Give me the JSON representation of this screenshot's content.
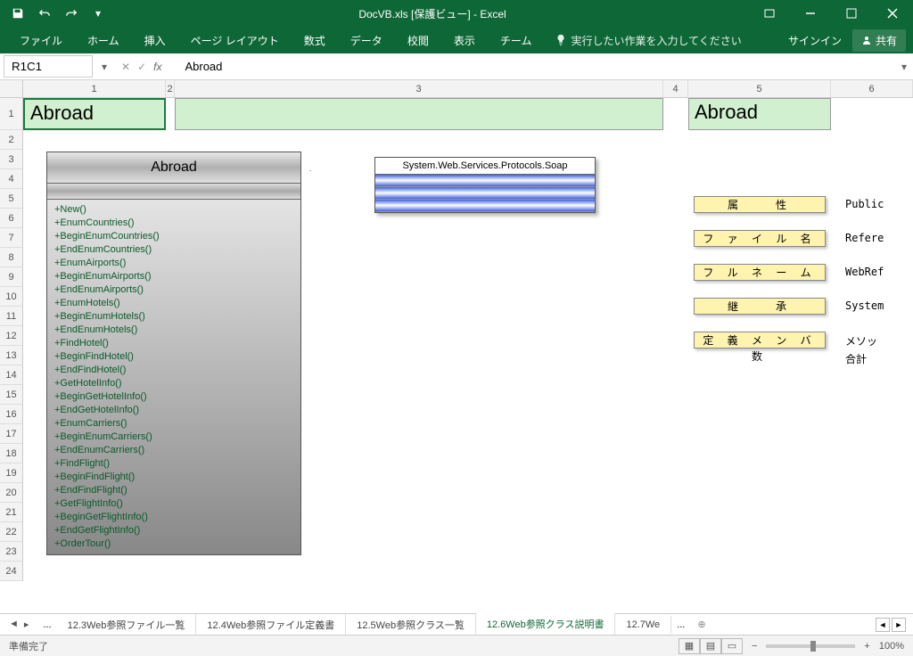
{
  "titlebar": {
    "title": "DocVB.xls  [保護ビュー] - Excel"
  },
  "ribbon": {
    "tabs": [
      "ファイル",
      "ホーム",
      "挿入",
      "ページ レイアウト",
      "数式",
      "データ",
      "校閲",
      "表示",
      "チーム"
    ],
    "tell_me": "実行したい作業を入力してください",
    "signin": "サインイン",
    "share": "共有"
  },
  "formula_bar": {
    "name_box": "R1C1",
    "fx": "fx",
    "formula": "Abroad"
  },
  "columns": [
    "1",
    "2",
    "3",
    "4",
    "5",
    "6"
  ],
  "rows": [
    "1",
    "2",
    "3",
    "4",
    "5",
    "6",
    "7",
    "8",
    "9",
    "10",
    "11",
    "12",
    "13",
    "14",
    "15",
    "16",
    "17",
    "18",
    "19",
    "20",
    "21",
    "22",
    "23",
    "24"
  ],
  "headers": {
    "c1": "Abroad",
    "c3": "",
    "c5": "Abroad"
  },
  "class_diagram": {
    "title": "Abroad",
    "members": [
      "+New()",
      "+EnumCountries()",
      "+BeginEnumCountries()",
      "+EndEnumCountries()",
      "+EnumAirports()",
      "+BeginEnumAirports()",
      "+EndEnumAirports()",
      "+EnumHotels()",
      "+BeginEnumHotels()",
      "+EndEnumHotels()",
      "+FindHotel()",
      "+BeginFindHotel()",
      "+EndFindHotel()",
      "+GetHotelInfo()",
      "+BeginGetHotelInfo()",
      "+EndGetHotelInfo()",
      "+EnumCarriers()",
      "+BeginEnumCarriers()",
      "+EndEnumCarriers()",
      "+FindFlight()",
      "+BeginFindFlight()",
      "+EndFindFlight()",
      "+GetFlightInfo()",
      "+BeginGetFlightInfo()",
      "+EndGetFlightInfo()",
      "+OrderTour()"
    ]
  },
  "soap_box": "System.Web.Services.Protocols.Soap",
  "properties": [
    {
      "label": "属　　性",
      "value": "Public"
    },
    {
      "label": "フ ァ イ ル 名",
      "value": "Refere"
    },
    {
      "label": "フ ル ネ ー ム",
      "value": "WebRef"
    },
    {
      "label": "継　　承",
      "value": "System"
    },
    {
      "label": "定 義 メ ン バ 数",
      "value": "メソッ"
    }
  ],
  "total_label": "合計",
  "sheet_tabs": {
    "ellipsis": "...",
    "tabs": [
      "12.3Web参照ファイル一覧",
      "12.4Web参照ファイル定義書",
      "12.5Web参照クラス一覧",
      "12.6Web参照クラス説明書",
      "12.7We"
    ],
    "active_index": 3,
    "trailing": "..."
  },
  "statusbar": {
    "ready": "準備完了",
    "zoom": "100%"
  }
}
